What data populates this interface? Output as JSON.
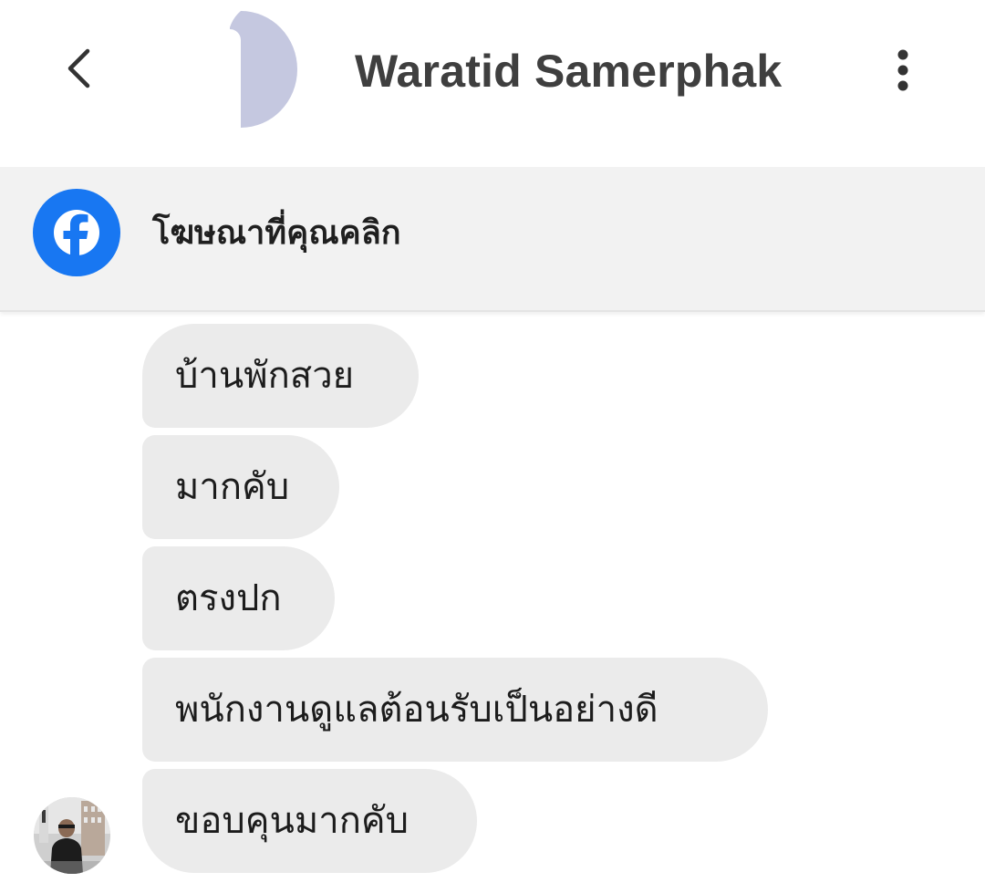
{
  "header": {
    "contact_name": "Waratid Samerphak",
    "back_icon": "chevron-left-icon",
    "more_icon": "more-vertical-icon",
    "avatar_color": "#c5c8e0"
  },
  "ad_banner": {
    "icon": "facebook-icon",
    "label": "โฆษณาที่คุณคลิก",
    "brand_color": "#1877f2"
  },
  "messages": [
    {
      "text": "บ้านพักสวย"
    },
    {
      "text": "มากคับ"
    },
    {
      "text": "ตรงปก"
    },
    {
      "text": "พนักงานดูแลต้อนรับเป็นอย่างดี"
    },
    {
      "text": "ขอบคุนมากคับ"
    }
  ],
  "colors": {
    "bubble_bg": "#ebebeb",
    "banner_bg": "#f2f2f2",
    "name_color": "#3f3f3f"
  }
}
